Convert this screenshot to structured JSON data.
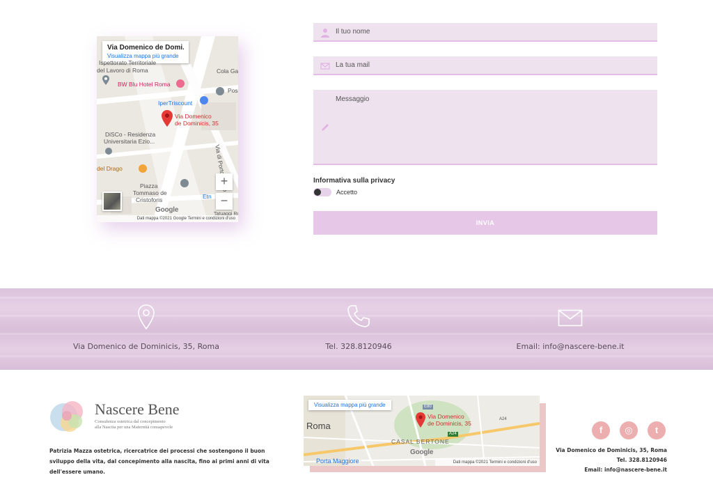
{
  "map_top": {
    "info_title": "Via Domenico de Domi...",
    "info_link": "Visualizza mappa più grande",
    "labels": {
      "lavoro_1": "Ispettorato Territoriale",
      "lavoro_2": "del Lavoro di Roma",
      "hotel": "BW Blu Hotel Roma",
      "iper": "IperTriscount",
      "colaga": "Cola Ga",
      "pos": "Pos",
      "pin_1": "Via Domenico",
      "pin_2": "de Dominicis, 35",
      "disco_1": "DiSCo - Residenza",
      "disco_2": "Universitaria Ezio...",
      "drago": "del Drago",
      "piazza_1": "Piazza",
      "piazza_2": "Tommaso de",
      "piazza_3": "Cristoforis",
      "street": "Via di Portonaccio",
      "etn": "Etn",
      "tatuaggi": "Tatuaggi Ror"
    },
    "zoom_in": "+",
    "zoom_out": "−",
    "google": "Google",
    "footer": "Dati mappa ©2021 Google   Termini e condizioni d'uso"
  },
  "form": {
    "name_placeholder": "Il tuo nome",
    "email_placeholder": "La tua mail",
    "message_placeholder": "Messaggio",
    "privacy_title": "Informativa sulla privacy",
    "accept_label": "Accetto",
    "submit_label": "INVIA"
  },
  "contacts": {
    "address": "Via Domenico de Dominicis, 35, Roma",
    "phone": "Tel. 328.8120946",
    "email": "Email: info@nascere-bene.it"
  },
  "footer": {
    "logo_name": "Nascere Bene",
    "logo_sub_1": "Consulenza ostetrica dal concepimento",
    "logo_sub_2": "alla Nascita per una Maternità consapevole",
    "description": "Patrizia Mazza ostetrica, ricercatrice dei processi che sostengono il buon sviluppo della vita, dal concepimento alla nascita, fino ai primi anni di vita dell'essere umano.",
    "map_link": "Visualizza mappa più grande",
    "map_labels": {
      "roma": "Roma",
      "pin_1": "Via Domenico",
      "pin_2": "de Dominicis, 35",
      "casal": "CASAL BERTONE",
      "porta": "Porta Maggiore",
      "a24": "A24",
      "a24b": "A24",
      "e80": "E80",
      "google": "Google",
      "footer": "Dati mappa ©2021   Termini e condizioni d'uso"
    },
    "social": {
      "facebook": "f",
      "instagram": "◎",
      "twitter": "t"
    },
    "address": "Via Domenico de Dominicis, 35, Roma",
    "phone": "Tel. 328.8120946",
    "email": "Email: info@nascere-bene.it"
  },
  "colors": {
    "field_bg": "#efe2ef",
    "button_bg": "#e6c7e7",
    "band": "#dcc3dd",
    "social": "#ecaeae",
    "pin": "#e53935"
  }
}
